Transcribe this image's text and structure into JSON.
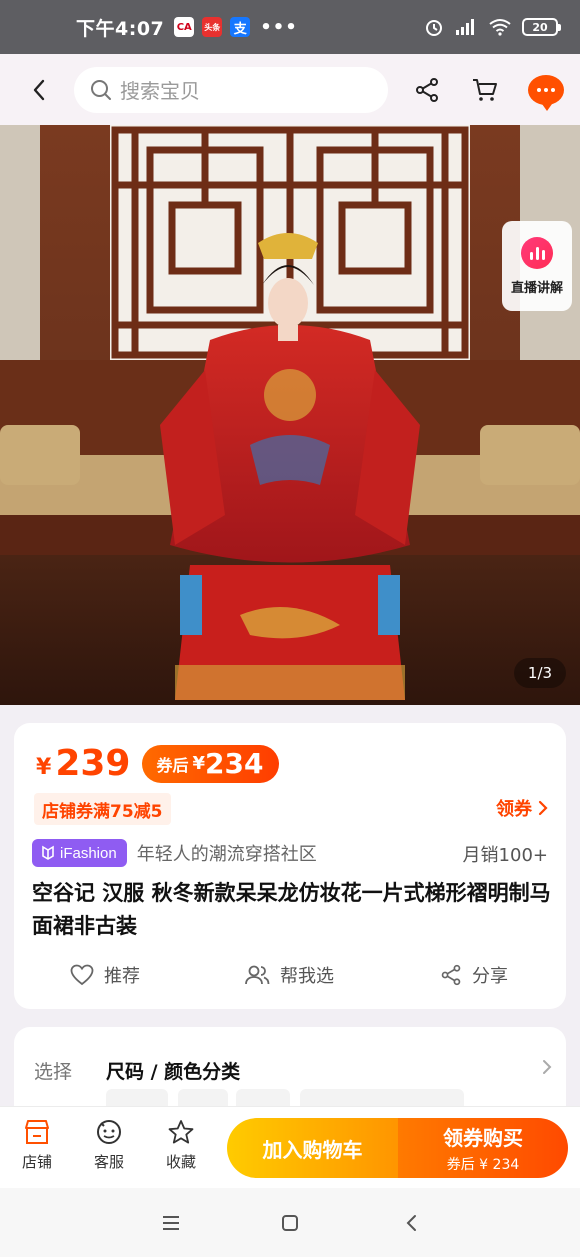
{
  "status_bar": {
    "time": "下午4:07",
    "battery": "20",
    "apps": [
      "CA",
      "头条",
      "支"
    ],
    "dots": "•••"
  },
  "search": {
    "placeholder": "搜索宝贝"
  },
  "gallery": {
    "page_indicator": "1/3",
    "live_label": "直播讲解"
  },
  "price": {
    "currency": "¥",
    "current": "239",
    "coupon_label": "券后",
    "coupon_currency": "¥",
    "after_coupon": "234",
    "accent_color": "#ff4400"
  },
  "store_coupon": {
    "text": "店铺券满75减5",
    "action": "领券"
  },
  "brand_tag": {
    "badge": "iFashion",
    "tagline": "年轻人的潮流穿搭社区"
  },
  "monthly_sales": "月销100+",
  "product": {
    "title": "空谷记 汉服 秋冬新款呆呆龙仿妆花一片式梯形褶明制马面裙非古装"
  },
  "actions": {
    "recommend": "推荐",
    "help_choose": "帮我选",
    "share": "分享"
  },
  "selection": {
    "label": "选择",
    "value": "尺码 / 颜色分类"
  },
  "bottom_bar": {
    "store": "店铺",
    "service": "客服",
    "favorite": "收藏",
    "add_to_cart": "加入购物车",
    "buy_now": "领券购买",
    "buy_sub": "券后 ¥ 234"
  }
}
